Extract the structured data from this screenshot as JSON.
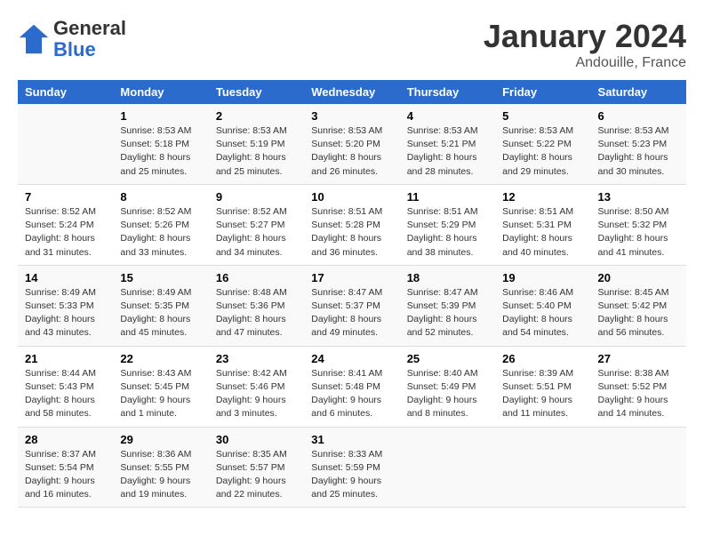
{
  "header": {
    "logo": {
      "general": "General",
      "blue": "Blue"
    },
    "title": "January 2024",
    "location": "Andouille, France"
  },
  "columns": [
    "Sunday",
    "Monday",
    "Tuesday",
    "Wednesday",
    "Thursday",
    "Friday",
    "Saturday"
  ],
  "weeks": [
    [
      {
        "day": "",
        "info": ""
      },
      {
        "day": "1",
        "info": "Sunrise: 8:53 AM\nSunset: 5:18 PM\nDaylight: 8 hours\nand 25 minutes."
      },
      {
        "day": "2",
        "info": "Sunrise: 8:53 AM\nSunset: 5:19 PM\nDaylight: 8 hours\nand 25 minutes."
      },
      {
        "day": "3",
        "info": "Sunrise: 8:53 AM\nSunset: 5:20 PM\nDaylight: 8 hours\nand 26 minutes."
      },
      {
        "day": "4",
        "info": "Sunrise: 8:53 AM\nSunset: 5:21 PM\nDaylight: 8 hours\nand 28 minutes."
      },
      {
        "day": "5",
        "info": "Sunrise: 8:53 AM\nSunset: 5:22 PM\nDaylight: 8 hours\nand 29 minutes."
      },
      {
        "day": "6",
        "info": "Sunrise: 8:53 AM\nSunset: 5:23 PM\nDaylight: 8 hours\nand 30 minutes."
      }
    ],
    [
      {
        "day": "7",
        "info": "Sunrise: 8:52 AM\nSunset: 5:24 PM\nDaylight: 8 hours\nand 31 minutes."
      },
      {
        "day": "8",
        "info": "Sunrise: 8:52 AM\nSunset: 5:26 PM\nDaylight: 8 hours\nand 33 minutes."
      },
      {
        "day": "9",
        "info": "Sunrise: 8:52 AM\nSunset: 5:27 PM\nDaylight: 8 hours\nand 34 minutes."
      },
      {
        "day": "10",
        "info": "Sunrise: 8:51 AM\nSunset: 5:28 PM\nDaylight: 8 hours\nand 36 minutes."
      },
      {
        "day": "11",
        "info": "Sunrise: 8:51 AM\nSunset: 5:29 PM\nDaylight: 8 hours\nand 38 minutes."
      },
      {
        "day": "12",
        "info": "Sunrise: 8:51 AM\nSunset: 5:31 PM\nDaylight: 8 hours\nand 40 minutes."
      },
      {
        "day": "13",
        "info": "Sunrise: 8:50 AM\nSunset: 5:32 PM\nDaylight: 8 hours\nand 41 minutes."
      }
    ],
    [
      {
        "day": "14",
        "info": "Sunrise: 8:49 AM\nSunset: 5:33 PM\nDaylight: 8 hours\nand 43 minutes."
      },
      {
        "day": "15",
        "info": "Sunrise: 8:49 AM\nSunset: 5:35 PM\nDaylight: 8 hours\nand 45 minutes."
      },
      {
        "day": "16",
        "info": "Sunrise: 8:48 AM\nSunset: 5:36 PM\nDaylight: 8 hours\nand 47 minutes."
      },
      {
        "day": "17",
        "info": "Sunrise: 8:47 AM\nSunset: 5:37 PM\nDaylight: 8 hours\nand 49 minutes."
      },
      {
        "day": "18",
        "info": "Sunrise: 8:47 AM\nSunset: 5:39 PM\nDaylight: 8 hours\nand 52 minutes."
      },
      {
        "day": "19",
        "info": "Sunrise: 8:46 AM\nSunset: 5:40 PM\nDaylight: 8 hours\nand 54 minutes."
      },
      {
        "day": "20",
        "info": "Sunrise: 8:45 AM\nSunset: 5:42 PM\nDaylight: 8 hours\nand 56 minutes."
      }
    ],
    [
      {
        "day": "21",
        "info": "Sunrise: 8:44 AM\nSunset: 5:43 PM\nDaylight: 8 hours\nand 58 minutes."
      },
      {
        "day": "22",
        "info": "Sunrise: 8:43 AM\nSunset: 5:45 PM\nDaylight: 9 hours\nand 1 minute."
      },
      {
        "day": "23",
        "info": "Sunrise: 8:42 AM\nSunset: 5:46 PM\nDaylight: 9 hours\nand 3 minutes."
      },
      {
        "day": "24",
        "info": "Sunrise: 8:41 AM\nSunset: 5:48 PM\nDaylight: 9 hours\nand 6 minutes."
      },
      {
        "day": "25",
        "info": "Sunrise: 8:40 AM\nSunset: 5:49 PM\nDaylight: 9 hours\nand 8 minutes."
      },
      {
        "day": "26",
        "info": "Sunrise: 8:39 AM\nSunset: 5:51 PM\nDaylight: 9 hours\nand 11 minutes."
      },
      {
        "day": "27",
        "info": "Sunrise: 8:38 AM\nSunset: 5:52 PM\nDaylight: 9 hours\nand 14 minutes."
      }
    ],
    [
      {
        "day": "28",
        "info": "Sunrise: 8:37 AM\nSunset: 5:54 PM\nDaylight: 9 hours\nand 16 minutes."
      },
      {
        "day": "29",
        "info": "Sunrise: 8:36 AM\nSunset: 5:55 PM\nDaylight: 9 hours\nand 19 minutes."
      },
      {
        "day": "30",
        "info": "Sunrise: 8:35 AM\nSunset: 5:57 PM\nDaylight: 9 hours\nand 22 minutes."
      },
      {
        "day": "31",
        "info": "Sunrise: 8:33 AM\nSunset: 5:59 PM\nDaylight: 9 hours\nand 25 minutes."
      },
      {
        "day": "",
        "info": ""
      },
      {
        "day": "",
        "info": ""
      },
      {
        "day": "",
        "info": ""
      }
    ]
  ]
}
